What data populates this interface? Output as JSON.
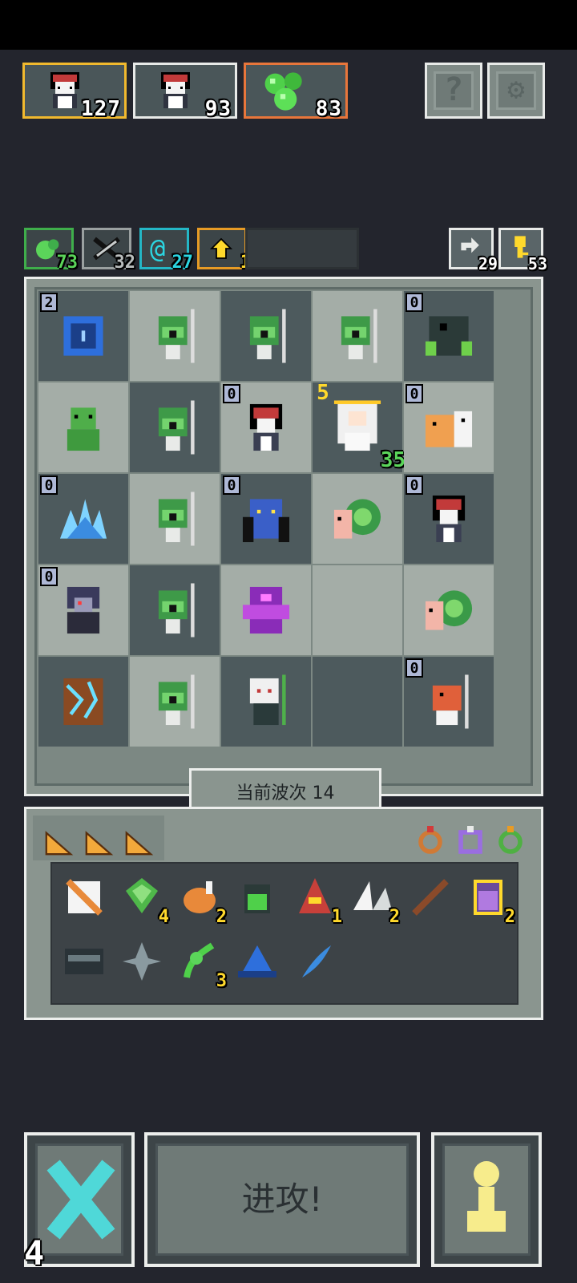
{
  "party": [
    {
      "name": "maid-girl-icon",
      "count": "127"
    },
    {
      "name": "maid-girl-icon",
      "count": "93"
    },
    {
      "name": "green-slime-icon",
      "count": "83"
    }
  ],
  "top_buttons": {
    "help_icon": "question-mark-icon",
    "settings_icon": "gear-icon"
  },
  "resources": [
    {
      "icon": "green-coin-icon",
      "value": "73",
      "color": "green"
    },
    {
      "icon": "sword-icon",
      "value": "32",
      "color": "gray"
    },
    {
      "icon": "swirl-icon",
      "value": "27",
      "color": "cyan"
    },
    {
      "icon": "arrow-up-icon",
      "value": "1",
      "color": "yellow"
    }
  ],
  "right_counters": [
    {
      "icon": "reroll-icon",
      "value": "29"
    },
    {
      "icon": "key-icon",
      "value": "53"
    }
  ],
  "board": {
    "rows": [
      [
        {
          "unit": "blue-portal",
          "lvl": "2"
        },
        {
          "unit": "goblin-spearman"
        },
        {
          "unit": "goblin-spearman"
        },
        {
          "unit": "goblin-spearman"
        },
        {
          "unit": "dark-golem",
          "lvl": "0"
        }
      ],
      [
        {
          "unit": "green-goblin"
        },
        {
          "unit": "goblin-spearman"
        },
        {
          "unit": "maid-girl",
          "lvl": "0"
        },
        {
          "unit": "white-hair-girl",
          "lvl": "5",
          "badge": "35"
        },
        {
          "unit": "fire-beasts",
          "lvl": "0"
        }
      ],
      [
        {
          "unit": "ice-crystal",
          "lvl": "0"
        },
        {
          "unit": "goblin-spearman"
        },
        {
          "unit": "blue-demon",
          "lvl": "0"
        },
        {
          "unit": "snail"
        },
        {
          "unit": "maid-girl",
          "lvl": "0"
        }
      ],
      [
        {
          "unit": "medusa",
          "lvl": "0"
        },
        {
          "unit": "goblin-spearman"
        },
        {
          "unit": "purple-golem"
        },
        {
          "unit": ""
        },
        {
          "unit": "snail"
        }
      ],
      [
        {
          "unit": "wood-golem"
        },
        {
          "unit": "goblin-spearman"
        },
        {
          "unit": "skeleton-mage"
        },
        {
          "unit": ""
        },
        {
          "unit": "orange-spearman",
          "lvl": "0"
        }
      ]
    ],
    "wave_label": "当前波次 14"
  },
  "inventory": {
    "tabs": [
      "cheese-tab",
      "cheese-tab",
      "cheese-tab"
    ],
    "rings": [
      "ring-icon",
      "purple-ring-icon",
      "green-ring-icon"
    ],
    "items": [
      {
        "icon": "cloth-icon",
        "count": ""
      },
      {
        "icon": "green-gem-icon",
        "count": "4"
      },
      {
        "icon": "meat-icon",
        "count": "2"
      },
      {
        "icon": "potion-jar-icon",
        "count": ""
      },
      {
        "icon": "red-helm-icon",
        "count": "1"
      },
      {
        "icon": "white-wing-icon",
        "count": "2"
      },
      {
        "icon": "wand-icon",
        "count": ""
      },
      {
        "icon": "purple-jar-icon",
        "count": "2"
      },
      {
        "icon": "chest-icon",
        "count": ""
      },
      {
        "icon": "shuriken-icon",
        "count": ""
      },
      {
        "icon": "green-plant-icon",
        "count": "3"
      },
      {
        "icon": "blue-hat-icon",
        "count": ""
      },
      {
        "icon": "blue-feather-icon",
        "count": ""
      }
    ]
  },
  "bottom": {
    "cancel_count": "4",
    "attack_label": "进攻!",
    "pawn_icon": "pawn-icon"
  }
}
